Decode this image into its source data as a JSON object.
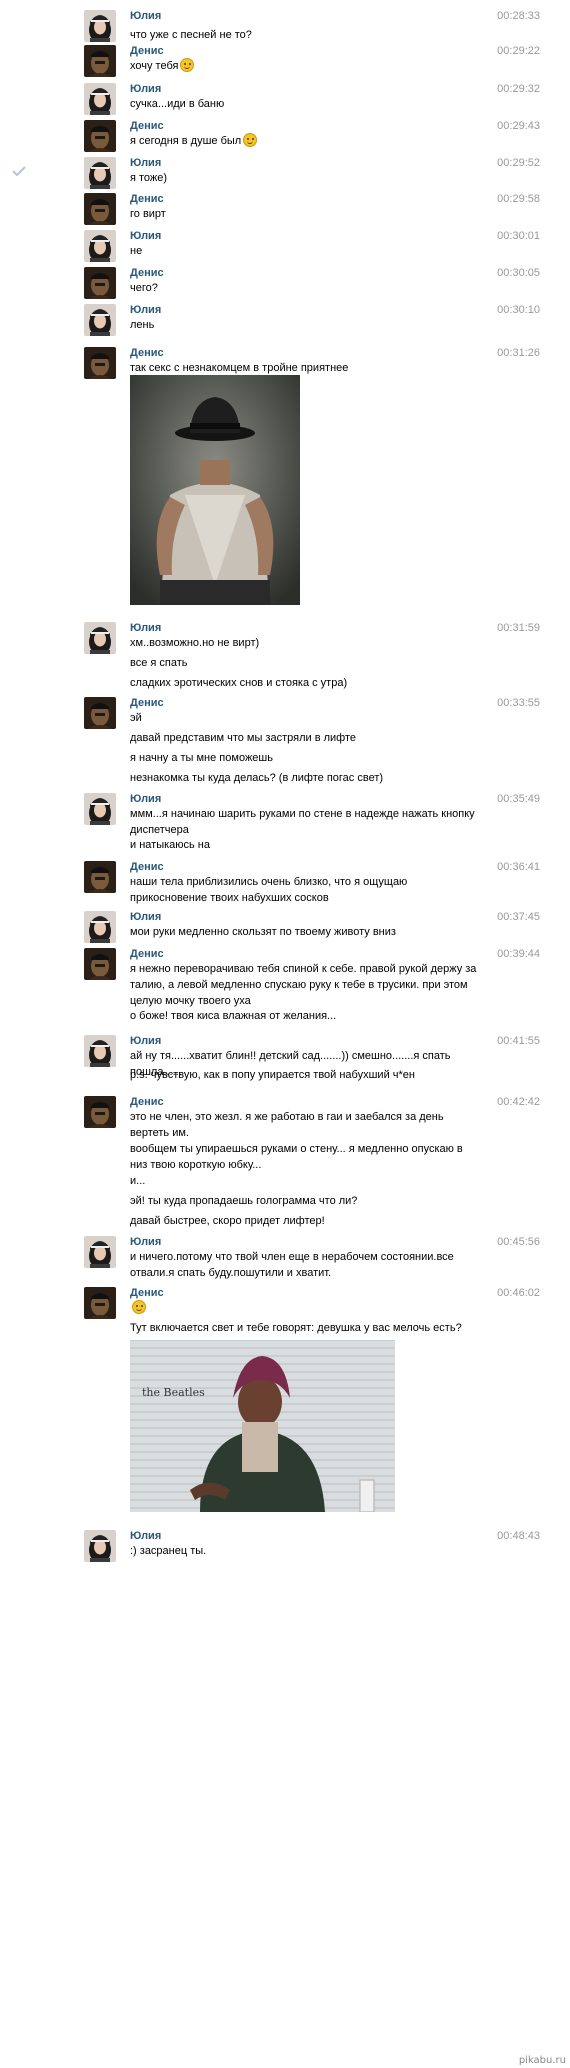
{
  "users": {
    "julia": "Юлия",
    "denis": "Денис"
  },
  "messages": [
    {
      "sender": "julia",
      "time": "00:28:33",
      "lines": [
        "что уже с песней не то?"
      ]
    },
    {
      "sender": "denis",
      "time": "00:29:22",
      "lines": [
        "хочу тебя"
      ],
      "smile": true
    },
    {
      "sender": "julia",
      "time": "00:29:32",
      "lines": [
        "сучка...иди в баню"
      ]
    },
    {
      "sender": "denis",
      "time": "00:29:43",
      "lines": [
        "я сегодня в душе был"
      ],
      "smile": true
    },
    {
      "sender": "julia",
      "time": "00:29:52",
      "lines": [
        "я тоже)"
      ]
    },
    {
      "sender": "denis",
      "time": "00:29:58",
      "lines": [
        "го вирт"
      ]
    },
    {
      "sender": "julia",
      "time": "00:30:01",
      "lines": [
        "не"
      ]
    },
    {
      "sender": "denis",
      "time": "00:30:05",
      "lines": [
        "чего?"
      ]
    },
    {
      "sender": "julia",
      "time": "00:30:10",
      "lines": [
        "лень"
      ]
    },
    {
      "sender": "denis",
      "time": "00:31:26",
      "lines": [
        "так секс с незнакомцем в тройне приятнее"
      ]
    },
    {
      "sender": "julia",
      "time": "00:31:59",
      "lines": [
        "хм..возможно.но не вирт)",
        "все я спать",
        "сладких эротических снов и стояка с утра)"
      ]
    },
    {
      "sender": "denis",
      "time": "00:33:55",
      "lines": [
        "эй",
        "давай представим что мы застряли в лифте",
        "я начну а ты мне поможешь",
        "незнакомка ты куда делась? (в лифте погас свет)"
      ]
    },
    {
      "sender": "julia",
      "time": "00:35:49",
      "lines": [
        "ммм...я начинаю шарить руками по стене в надежде нажать кнопку диспетчера",
        "и натыкаюсь на"
      ]
    },
    {
      "sender": "denis",
      "time": "00:36:41",
      "lines": [
        "наши тела приблизились очень близко, что я ощущаю прикосновение твоих набухших сосков"
      ]
    },
    {
      "sender": "julia",
      "time": "00:37:45",
      "lines": [
        "мои руки медленно скользят по твоему животу вниз"
      ]
    },
    {
      "sender": "denis",
      "time": "00:39:44",
      "lines": [
        "я нежно переворачиваю тебя спиной к себе. правой рукой держу за талию, а левой медленно спускаю руку к тебе в трусики. при этом целую мочку твоего уха",
        "о боже! твоя киса влажная от желания..."
      ]
    },
    {
      "sender": "julia",
      "time": "00:41:55",
      "lines": [
        "ай ну тя......хватит блин!! детский сад.......)) смешно.......я спать пошла......",
        "p.s. чувствую, как в попу упирается твой набухший ч*ен"
      ]
    },
    {
      "sender": "denis",
      "time": "00:42:42",
      "lines": [
        "это не член, это жезл. я же работаю в гаи и заебался за день вертеть им.",
        "вообщем ты упираешься руками о стену... я медленно опускаю в низ твою короткую юбку...",
        "и...",
        "эй! ты куда пропадаешь голограмма что ли?",
        "давай быстрее, скоро придет лифтер!"
      ]
    },
    {
      "sender": "julia",
      "time": "00:45:56",
      "lines": [
        "и ничего.потому что твой член еще в нерабочем состоянии.все отвали.я спать буду.пошутили и хватит."
      ]
    },
    {
      "sender": "denis",
      "time": "00:46:02",
      "lines": [
        "",
        "Тут включается свет и тебе говорят: девушка у вас мелочь есть?"
      ],
      "smile_line": 0
    },
    {
      "sender": "julia",
      "time": "00:48:43",
      "lines": [
        ":) засранец ты."
      ]
    }
  ],
  "photo2_text": "the Beatles",
  "footer": "pikabu.ru",
  "colors": {
    "name": "#2b587a",
    "time": "#999999"
  }
}
